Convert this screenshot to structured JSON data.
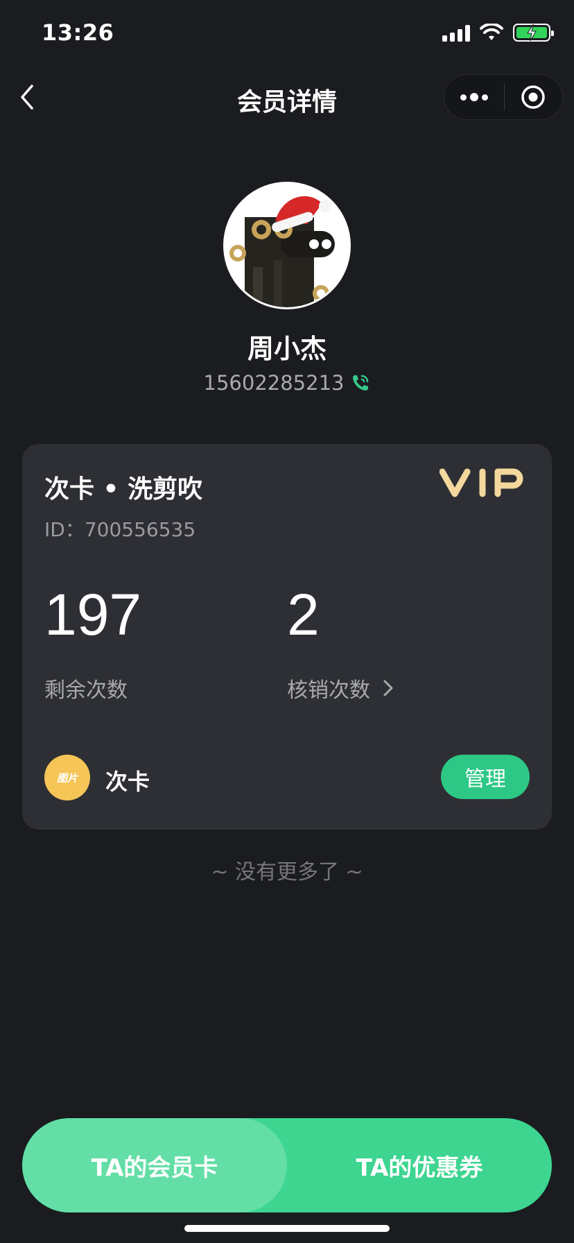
{
  "status_bar": {
    "time": "13:26"
  },
  "nav": {
    "title": "会员详情"
  },
  "member": {
    "name": "周小杰",
    "phone": "15602285213"
  },
  "card": {
    "title": "次卡 • 洗剪吹",
    "id_label": "ID：700556535",
    "vip_text": "VIP",
    "remaining_value": "197",
    "remaining_label": "剩余次数",
    "used_value": "2",
    "used_label": "核销次数",
    "footer_icon_text": "图片",
    "footer_label": "次卡",
    "manage_label": "管理"
  },
  "no_more_text": "~ 没有更多了 ~",
  "bottom_tabs": {
    "left": "TA的会员卡",
    "right": "TA的优惠券"
  },
  "colors": {
    "accent": "#3dd590",
    "vip_gold": "#f3d79c",
    "background": "#1b1c20",
    "card": "#2e2f34"
  }
}
